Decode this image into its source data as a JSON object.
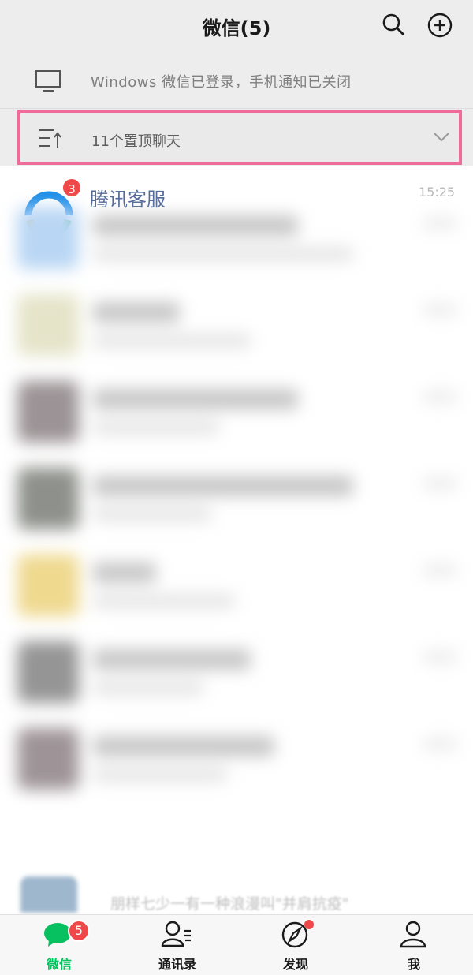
{
  "header": {
    "title": "微信(5)"
  },
  "banner": {
    "text": "Windows 微信已登录，手机通知已关闭"
  },
  "pinned": {
    "text": "11个置顶聊天"
  },
  "chats": [
    {
      "name": "腾讯客服",
      "time": "15:25",
      "unread": "3"
    }
  ],
  "partial_preview": "朋样七少一有一种浪漫叫\"并肩抗疫\"",
  "tabs": [
    {
      "label": "微信",
      "badge": "5",
      "active": true
    },
    {
      "label": "通讯录"
    },
    {
      "label": "发现",
      "dot": true
    },
    {
      "label": "我"
    }
  ],
  "colors": {
    "accent": "#07c160",
    "badge": "#f04848",
    "highlight_border": "#f06b9a",
    "chat_name": "#536a9a"
  }
}
